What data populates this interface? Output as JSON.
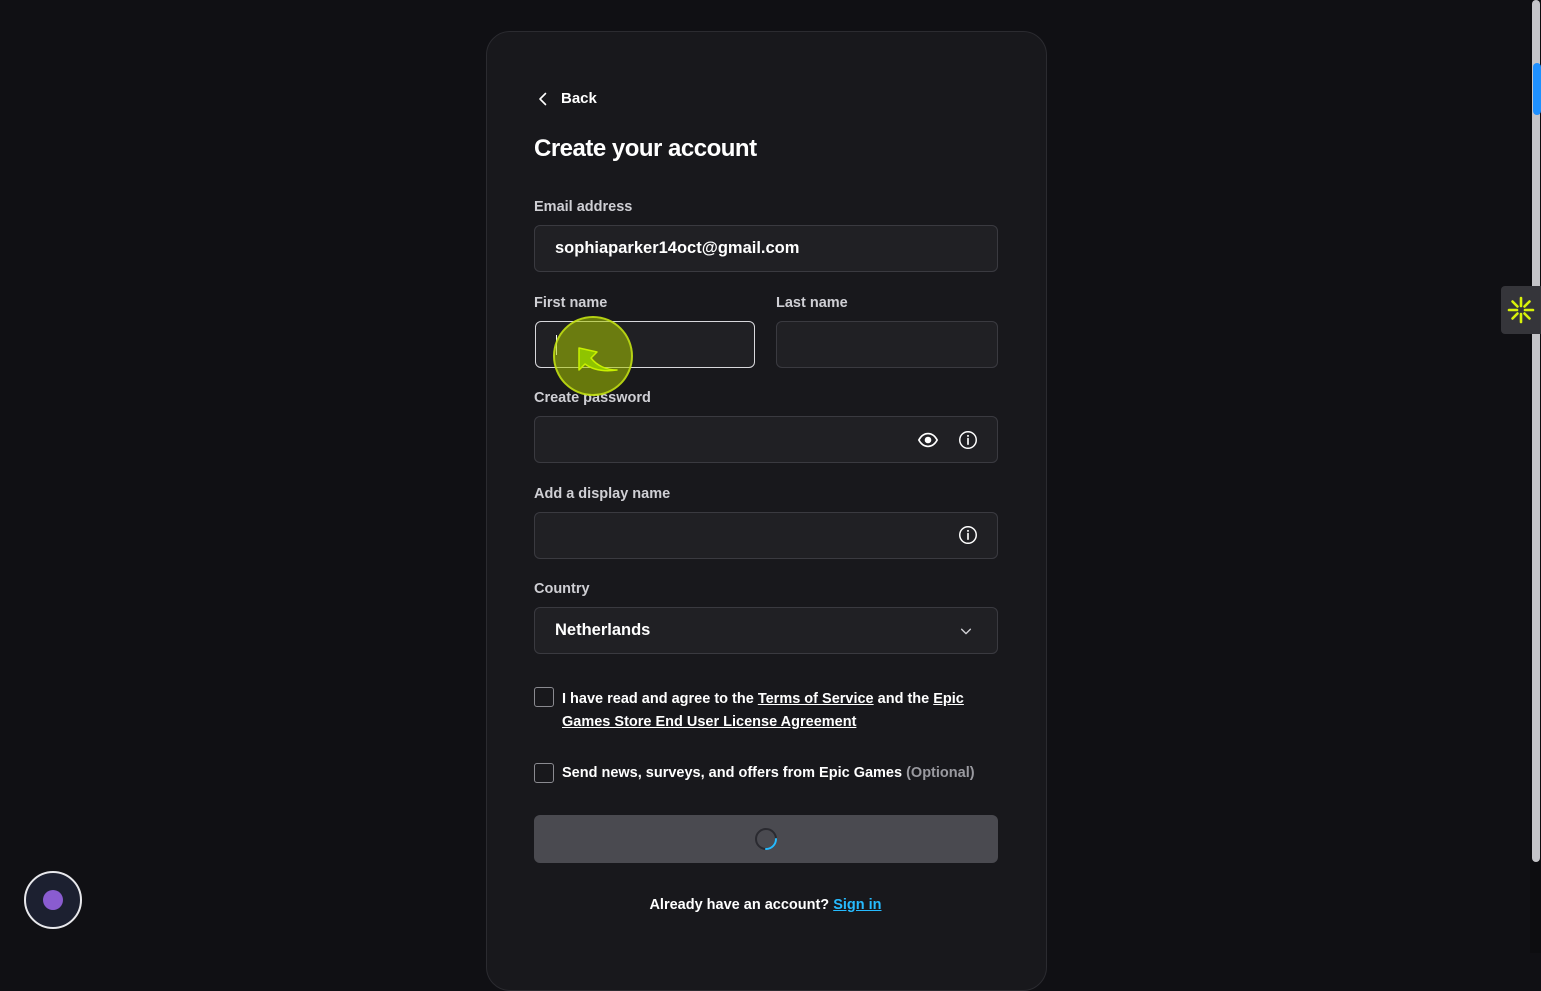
{
  "nav": {
    "back_label": "Back"
  },
  "title": "Create your account",
  "email": {
    "label": "Email address",
    "value": "sophiaparker14oct@gmail.com"
  },
  "first_name": {
    "label": "First name",
    "value": ""
  },
  "last_name": {
    "label": "Last name",
    "value": ""
  },
  "password": {
    "label": "Create password",
    "value": ""
  },
  "display_name": {
    "label": "Add a display name",
    "value": ""
  },
  "country": {
    "label": "Country",
    "selected": "Netherlands"
  },
  "terms": {
    "prefix": "I have read and agree to the ",
    "tos_link": "Terms of Service",
    "middle": " and the ",
    "eula_link_1": "Epic ",
    "eula_link_2": "Games Store End User License Agreement"
  },
  "marketing": {
    "text": "Send news, surveys, and offers from Epic Games ",
    "optional": "(Optional)"
  },
  "signin": {
    "prompt": "Already have an account? ",
    "link": "Sign in"
  },
  "colors": {
    "background": "#101014",
    "card": "#18181c",
    "link": "#26bbff",
    "submit_loading": "#4a4a50",
    "cursor_highlight": "#aac800"
  },
  "icons": {
    "back": "chevron-left-icon",
    "show_password": "eye-icon",
    "info": "info-icon",
    "dropdown": "chevron-down-icon",
    "loading": "spinner-icon"
  }
}
